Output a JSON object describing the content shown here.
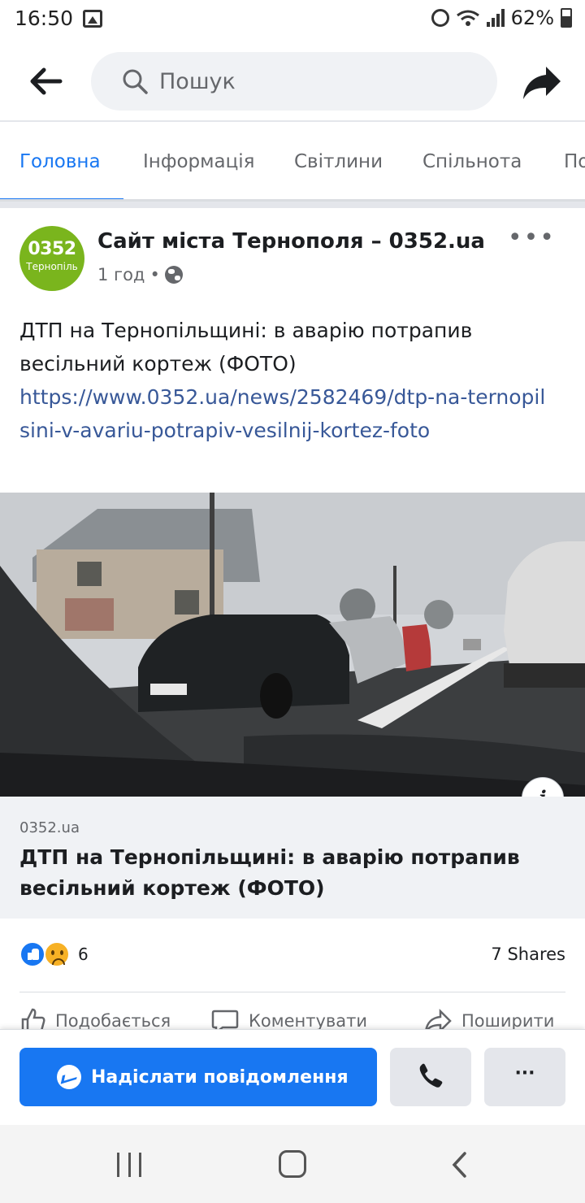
{
  "status_bar": {
    "time": "16:50",
    "battery": "62%"
  },
  "search": {
    "placeholder": "Пошук"
  },
  "tabs": [
    {
      "label": "Головна",
      "active": true
    },
    {
      "label": "Інформація",
      "active": false
    },
    {
      "label": "Світлини",
      "active": false
    },
    {
      "label": "Спільнота",
      "active": false
    },
    {
      "label": "По",
      "active": false
    }
  ],
  "post": {
    "avatar": {
      "big": "0352",
      "small": "Тернопіль"
    },
    "page_name": "Сайт міста Тернополя – 0352.ua",
    "time": "1 год",
    "separator": "•",
    "more_icon": "more-horizontal-icon",
    "text": "ДТП на Тернопільщині: в аварію потрапив весільний кортеж (ФОТО)",
    "link": "https://www.0352.ua/news/2582469/dtp-na-ternopilsini-v-avariu-potrapiv-vesilnij-kortez-foto",
    "link_preview": {
      "domain": "0352.ua",
      "title": "ДТП на Тернопільщині: в аварію потрапив весільний кортеж (ФОТО)"
    },
    "info_icon": "i",
    "reactions_count": "6",
    "shares": "7 Shares",
    "actions": [
      {
        "label": "Подобається",
        "icon": "like-icon"
      },
      {
        "label": "Коментувати",
        "icon": "comment-icon"
      },
      {
        "label": "Поширити",
        "icon": "share-icon"
      }
    ]
  },
  "bottom_bar": {
    "message_label": "Надіслати повідомлення",
    "more_label": "···"
  },
  "colors": {
    "accent": "#1877f2",
    "link": "#385898",
    "muted": "#65676b",
    "avatar_green": "#7ab51d"
  }
}
